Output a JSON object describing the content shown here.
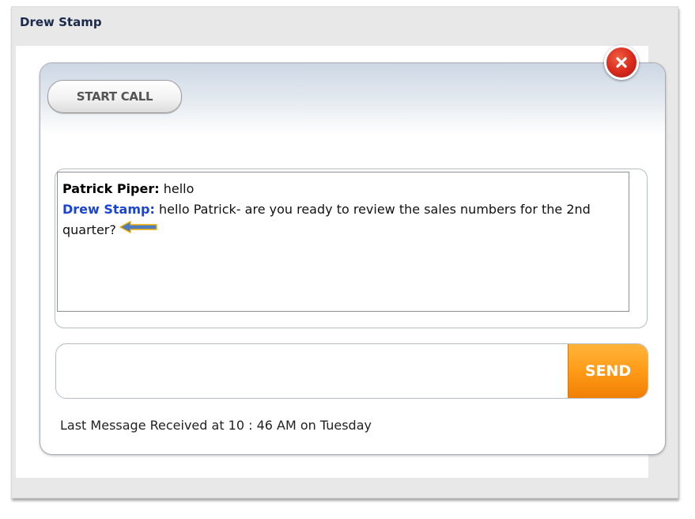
{
  "window": {
    "title": "Drew Stamp"
  },
  "header": {
    "start_call_label": "START CALL",
    "close_icon": "close-x-icon"
  },
  "conversation": {
    "messages": [
      {
        "sender": "Patrick Piper:",
        "text": " hello",
        "sender_color": "#000000"
      },
      {
        "sender": "Drew Stamp:",
        "text": " hello Patrick- are you ready to review the sales numbers for the 2nd quarter?",
        "sender_color": "#1a44d6"
      }
    ],
    "annotation_icon": "left-arrow-pointer-icon"
  },
  "composer": {
    "input_value": "",
    "input_placeholder": "",
    "send_label": "SEND"
  },
  "status": {
    "last_message": "Last Message Received at 10 : 46 AM on Tuesday"
  },
  "colors": {
    "send_orange": "#ff9b17",
    "close_red": "#d8281c",
    "drew_blue": "#1a44d6",
    "arrow_blue": "#4f7bbf"
  }
}
